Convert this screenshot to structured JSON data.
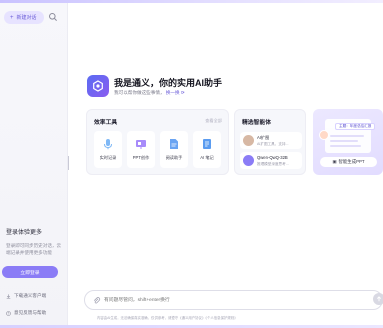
{
  "sidebar": {
    "new_chat_label": "新建对话",
    "login": {
      "title": "登录体验更多",
      "description": "登录即可同步历史对话，云端记录并使用更多功能"
    },
    "login_button": "立即登录",
    "links": [
      {
        "label": "下载通义客户端",
        "icon": "download-icon"
      },
      {
        "label": "意见反馈与帮助",
        "icon": "feedback-icon"
      }
    ]
  },
  "hero": {
    "title": "我是通义，你的实用AI助手",
    "subtitle": "我可以帮你做这些事情，",
    "more_link": "换一换"
  },
  "tools_card": {
    "title": "效率工具",
    "more": "查看全部",
    "items": [
      {
        "label": "实时记录",
        "icon": "microphone-icon",
        "color": "#7fb8f5"
      },
      {
        "label": "PPT创作",
        "icon": "ppt-icon",
        "color": "#a78bfa"
      },
      {
        "label": "阅读助手",
        "icon": "document-icon",
        "color": "#6aa4f2"
      },
      {
        "label": "AI 笔记",
        "icon": "notes-icon",
        "color": "#5b9cf0"
      }
    ]
  },
  "agents_card": {
    "title": "精选智能体",
    "items": [
      {
        "name": "AI扩图",
        "desc": "AI扩图工具，支持...",
        "color": "#d7b8a4"
      },
      {
        "name": "Qwen-QwQ-32B",
        "desc": "推理模型深度思考...",
        "color": "#8b7cf6"
      }
    ]
  },
  "ppt_card": {
    "tag": "主题：年度总结汇报",
    "button": "智能生成PPT"
  },
  "input": {
    "placeholder": "有问题尽管问，shift+enter换行"
  },
  "footer": "内容由AI生成，无法确保真实准确，仅供参考，请遵守《通义用户协议》《个人信息保护规则》"
}
